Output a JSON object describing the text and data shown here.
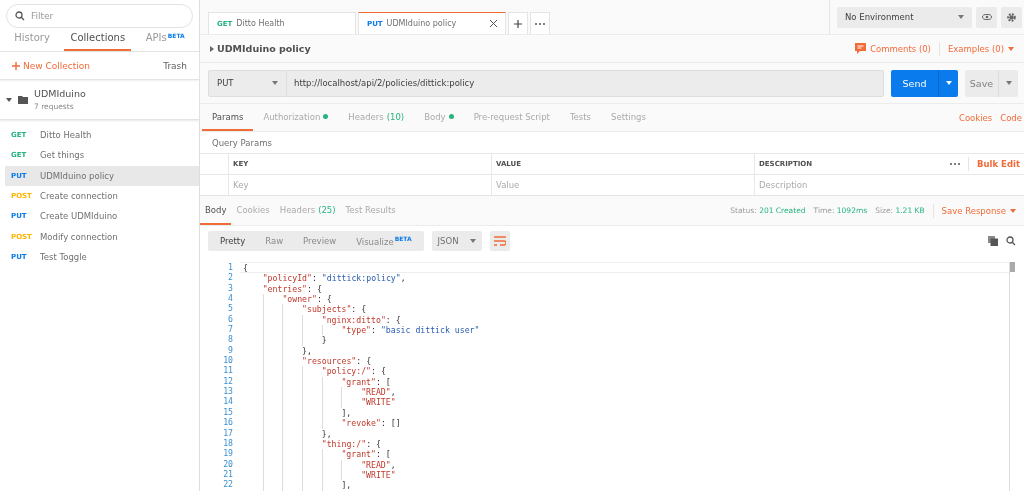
{
  "sidebar": {
    "filter": {
      "placeholder": "Filter"
    },
    "tabs": [
      {
        "label": "History",
        "selected": false
      },
      {
        "label": "Collections",
        "selected": true
      },
      {
        "label": "APIs",
        "badge": "BETA",
        "selected": false
      }
    ],
    "new_collection": "New Collection",
    "trash": "Trash",
    "collection": {
      "name": "UDMIduino",
      "count": "7 requests",
      "expanded": true,
      "items": [
        {
          "method": "GET",
          "color": "#26b47f",
          "name": "Ditto Health",
          "selected": false
        },
        {
          "method": "GET",
          "color": "#26b47f",
          "name": "Get things",
          "selected": false
        },
        {
          "method": "PUT",
          "color": "#097bed",
          "name": "UDMIduino policy",
          "selected": true
        },
        {
          "method": "POST",
          "color": "#ffb400",
          "name": "Create connection",
          "selected": false
        },
        {
          "method": "PUT",
          "color": "#097bed",
          "name": "Create UDMIduino",
          "selected": false
        },
        {
          "method": "POST",
          "color": "#ffb400",
          "name": "Modify connection",
          "selected": false
        },
        {
          "method": "PUT",
          "color": "#097bed",
          "name": "Test Toggle",
          "selected": false
        }
      ]
    }
  },
  "tabs": [
    {
      "method": "GET",
      "color": "#26b47f",
      "name": "Ditto Health",
      "selected": false
    },
    {
      "method": "PUT",
      "color": "#097bed",
      "name": "UDMIduino policy",
      "selected": true
    }
  ],
  "environment": "No Environment",
  "request": {
    "title": "UDMIduino policy",
    "comments": "Comments (0)",
    "examples": "Examples (0)",
    "method": "PUT",
    "url": "http://localhost/api/2/policies/dittick:policy",
    "send": "Send",
    "save": "Save",
    "tabs": [
      {
        "label": "Params",
        "selected": true,
        "dot": false
      },
      {
        "label": "Authorization",
        "selected": false,
        "dot": true
      },
      {
        "label": "Headers",
        "count": "(10)",
        "selected": false,
        "dot": false
      },
      {
        "label": "Body",
        "selected": false,
        "dot": true
      },
      {
        "label": "Pre-request Script",
        "selected": false,
        "dot": false
      },
      {
        "label": "Tests",
        "selected": false,
        "dot": false
      },
      {
        "label": "Settings",
        "selected": false,
        "dot": false
      }
    ],
    "links": [
      "Cookies",
      "Code"
    ],
    "query_params": {
      "title": "Query Params",
      "columns": [
        "KEY",
        "VALUE",
        "DESCRIPTION"
      ],
      "placeholders": [
        "Key",
        "Value",
        "Description"
      ],
      "bulk_edit": "Bulk Edit"
    }
  },
  "response": {
    "tabs": [
      {
        "label": "Body",
        "selected": true
      },
      {
        "label": "Cookies",
        "selected": false
      },
      {
        "label": "Headers",
        "count": "(25)",
        "selected": false
      },
      {
        "label": "Test Results",
        "selected": false
      }
    ],
    "status": [
      {
        "label": "Status:",
        "value": "201 Created"
      },
      {
        "label": "Time:",
        "value": "1092ms"
      },
      {
        "label": "Size:",
        "value": "1.21 KB"
      }
    ],
    "save_response": "Save Response",
    "formats": [
      {
        "label": "Pretty",
        "selected": true
      },
      {
        "label": "Raw",
        "selected": false
      },
      {
        "label": "Preview",
        "selected": false
      },
      {
        "label": "Visualize",
        "badge": "BETA",
        "selected": false
      }
    ],
    "language": "JSON",
    "code": [
      {
        "n": "1",
        "tokens": [
          {
            "kind": "punct",
            "text": "{"
          }
        ],
        "children": [
          {
            "n": "2",
            "tokens": [
              {
                "kind": "key",
                "text": "\"policyId\""
              },
              {
                "kind": "punct",
                "text": ": "
              },
              {
                "kind": "string",
                "text": "\"dittick:policy\""
              },
              {
                "kind": "punct",
                "text": ","
              }
            ]
          },
          {
            "n": "3",
            "tokens": [
              {
                "kind": "key",
                "text": "\"entries\""
              },
              {
                "kind": "punct",
                "text": ": {"
              }
            ],
            "children": [
              {
                "n": "4",
                "tokens": [
                  {
                    "kind": "key",
                    "text": "\"owner\""
                  },
                  {
                    "kind": "punct",
                    "text": ": {"
                  }
                ],
                "children": [
                  {
                    "n": "5",
                    "tokens": [
                      {
                        "kind": "key",
                        "text": "\"subjects\""
                      },
                      {
                        "kind": "punct",
                        "text": ": {"
                      }
                    ],
                    "children": [
                      {
                        "n": "6",
                        "tokens": [
                          {
                            "kind": "key",
                            "text": "\"nginx:ditto\""
                          },
                          {
                            "kind": "punct",
                            "text": ": {"
                          }
                        ],
                        "children": [
                          {
                            "n": "7",
                            "tokens": [
                              {
                                "kind": "key",
                                "text": "\"type\""
                              },
                              {
                                "kind": "punct",
                                "text": ": "
                              },
                              {
                                "kind": "string",
                                "text": "\"basic dittick user\""
                              }
                            ]
                          }
                        ]
                      },
                      {
                        "n": "8",
                        "tokens": [
                          {
                            "kind": "punct",
                            "text": "}"
                          }
                        ]
                      }
                    ]
                  },
                  {
                    "n": "9",
                    "tokens": [
                      {
                        "kind": "punct",
                        "text": "},"
                      }
                    ]
                  },
                  {
                    "n": "10",
                    "tokens": [
                      {
                        "kind": "key",
                        "text": "\"resources\""
                      },
                      {
                        "kind": "punct",
                        "text": ": {"
                      }
                    ],
                    "children": [
                      {
                        "n": "11",
                        "tokens": [
                          {
                            "kind": "key",
                            "text": "\"policy:/\""
                          },
                          {
                            "kind": "punct",
                            "text": ": {"
                          }
                        ],
                        "children": [
                          {
                            "n": "12",
                            "tokens": [
                              {
                                "kind": "key",
                                "text": "\"grant\""
                              },
                              {
                                "kind": "punct",
                                "text": ": ["
                              }
                            ],
                            "children": [
                              {
                                "n": "13",
                                "tokens": [
                                  {
                                    "kind": "key",
                                    "text": "\"READ\""
                                  },
                                  {
                                    "kind": "punct",
                                    "text": ","
                                  }
                                ]
                              },
                              {
                                "n": "14",
                                "tokens": [
                                  {
                                    "kind": "key",
                                    "text": "\"WRITE\""
                                  }
                                ]
                              }
                            ]
                          },
                          {
                            "n": "15",
                            "tokens": [
                              {
                                "kind": "punct",
                                "text": "],"
                              }
                            ]
                          },
                          {
                            "n": "16",
                            "tokens": [
                              {
                                "kind": "key",
                                "text": "\"revoke\""
                              },
                              {
                                "kind": "punct",
                                "text": ": []"
                              }
                            ]
                          }
                        ]
                      },
                      {
                        "n": "17",
                        "tokens": [
                          {
                            "kind": "punct",
                            "text": "},"
                          }
                        ]
                      },
                      {
                        "n": "18",
                        "tokens": [
                          {
                            "kind": "key",
                            "text": "\"thing:/\""
                          },
                          {
                            "kind": "punct",
                            "text": ": {"
                          }
                        ],
                        "children": [
                          {
                            "n": "19",
                            "tokens": [
                              {
                                "kind": "key",
                                "text": "\"grant\""
                              },
                              {
                                "kind": "punct",
                                "text": ": ["
                              }
                            ],
                            "children": [
                              {
                                "n": "20",
                                "tokens": [
                                  {
                                    "kind": "key",
                                    "text": "\"READ\""
                                  },
                                  {
                                    "kind": "punct",
                                    "text": ","
                                  }
                                ]
                              },
                              {
                                "n": "21",
                                "tokens": [
                                  {
                                    "kind": "key",
                                    "text": "\"WRITE\""
                                  }
                                ]
                              }
                            ]
                          },
                          {
                            "n": "22",
                            "tokens": [
                              {
                                "kind": "punct",
                                "text": "],"
                              }
                            ]
                          }
                        ]
                      }
                    ]
                  }
                ]
              }
            ]
          }
        ]
      }
    ]
  }
}
